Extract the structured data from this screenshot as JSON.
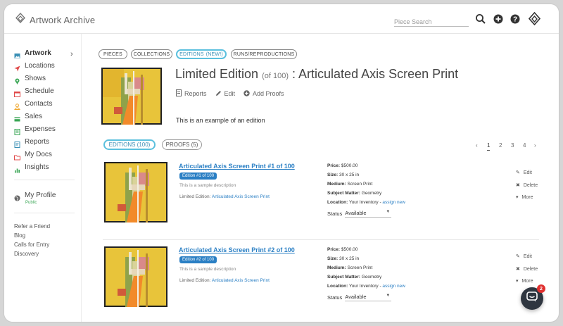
{
  "header": {
    "brand": "Artwork Archive",
    "search_placeholder": "Piece Search",
    "icons": [
      "search-icon",
      "add-icon",
      "help-icon",
      "logo-icon"
    ]
  },
  "sidebar": {
    "items": [
      {
        "label": "Artwork",
        "icon": "image-icon",
        "color": "#3a8fb5"
      },
      {
        "label": "Locations",
        "icon": "location-arrow-icon",
        "color": "#e04b4b"
      },
      {
        "label": "Shows",
        "icon": "pin-icon",
        "color": "#3aa655"
      },
      {
        "label": "Schedule",
        "icon": "calendar-icon",
        "color": "#e04b4b"
      },
      {
        "label": "Contacts",
        "icon": "user-icon",
        "color": "#f0a830"
      },
      {
        "label": "Sales",
        "icon": "card-icon",
        "color": "#3aa655"
      },
      {
        "label": "Expenses",
        "icon": "receipt-icon",
        "color": "#3aa655"
      },
      {
        "label": "Reports",
        "icon": "report-icon",
        "color": "#3a8fb5"
      },
      {
        "label": "My Docs",
        "icon": "folder-icon",
        "color": "#e04b4b"
      },
      {
        "label": "Insights",
        "icon": "chart-icon",
        "color": "#3aa655"
      }
    ],
    "profile": {
      "label": "My Profile",
      "sub": "Public"
    },
    "footer_links": [
      "Refer a Friend",
      "Blog",
      "Calls for Entry",
      "Discovery"
    ]
  },
  "main": {
    "top_tabs": [
      "PIECES",
      "COLLECTIONS",
      "EDITIONS",
      "RUNS/REPRODUCTIONS"
    ],
    "top_tab_new": "(NEW!)",
    "title_main": "Limited Edition",
    "title_of": "(of 100)",
    "title_rest": ": Articulated Axis Screen Print",
    "actions": {
      "reports": "Reports",
      "edit": "Edit",
      "add_proofs": "Add Proofs"
    },
    "description": "This is an example of an edition",
    "sub_tabs": [
      "EDITIONS (100)",
      "PROOFS (5)"
    ],
    "pager": {
      "prev": "‹",
      "pages": [
        "1",
        "2",
        "3",
        "4"
      ],
      "next": "›"
    },
    "rows": [
      {
        "title": "Articulated Axis Screen Print #1 of 100",
        "badge": "Edition #1 of 100",
        "desc": "This is a sample description",
        "le_label": "Limited Edition:",
        "le_link": "Articulated Axis Screen Print",
        "price_label": "Price:",
        "price": "$500.00",
        "size_label": "Size:",
        "size": "30 x 25 in",
        "medium_label": "Medium:",
        "medium": "Screen Print",
        "subject_label": "Subject Matter:",
        "subject": "Geometry",
        "location_label": "Location:",
        "location": "Your Inventory",
        "location_sep": " - ",
        "assign": "assign new",
        "status_label": "Status",
        "status_value": "Available",
        "act_edit": "Edit",
        "act_delete": "Delete",
        "act_more": "More"
      },
      {
        "title": "Articulated Axis Screen Print #2 of 100",
        "badge": "Edition #2 of 100",
        "desc": "This is a sample description",
        "le_label": "Limited Edition:",
        "le_link": "Articulated Axis Screen Print",
        "price_label": "Price:",
        "price": "$500.00",
        "size_label": "Size:",
        "size": "30 x 25 in",
        "medium_label": "Medium:",
        "medium": "Screen Print",
        "subject_label": "Subject Matter:",
        "subject": "Geometry",
        "location_label": "Location:",
        "location": "Your Inventory",
        "location_sep": " - ",
        "assign": "assign new",
        "status_label": "Status",
        "status_value": "Available",
        "act_edit": "Edit",
        "act_delete": "Delete",
        "act_more": "More"
      }
    ]
  },
  "chat": {
    "count": "2"
  },
  "colors": {
    "accent": "#5bc0de",
    "link": "#2a7fc4",
    "badge": "#2a7fc4",
    "chat_badge": "#e0302f"
  }
}
